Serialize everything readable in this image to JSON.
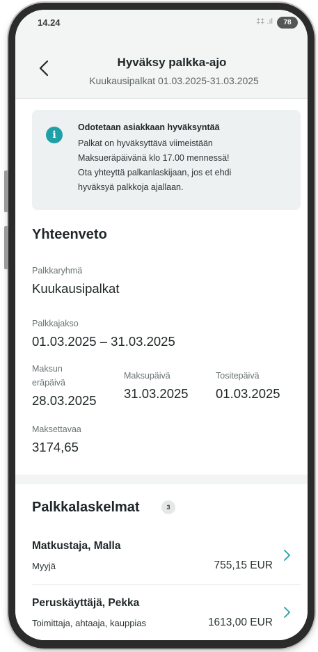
{
  "status_bar": {
    "time": "14.24",
    "signal_text": "‡‡ .ıl",
    "battery": "78"
  },
  "header": {
    "title": "Hyväksy palkka-ajo",
    "subtitle": "Kuukausipalkat 01.03.2025-31.03.2025"
  },
  "notice": {
    "icon": "info-icon",
    "title": "Odotetaan asiakkaan hyväksyntää",
    "lines": [
      "Palkat on hyväksyttävä viimeistään",
      "Maksueräpäivänä klo 17.00 mennessä!",
      "Ota yhteyttä palkanlaskijaan, jos et ehdi",
      "hyväksyä palkkoja ajallaan."
    ]
  },
  "summary": {
    "title": "Yhteenveto",
    "group_label": "Palkkaryhmä",
    "group_value": "Kuukausipalkat",
    "period_label": "Palkkajakso",
    "period_value": "01.03.2025 – 31.03.2025",
    "due_label_line1": "Maksun",
    "due_label_line2": "eräpäivä",
    "due_value": "28.03.2025",
    "paydate_label": "Maksupäivä",
    "paydate_value": "31.03.2025",
    "voucher_label": "Tositepäivä",
    "voucher_value": "01.03.2025",
    "payable_label": "Maksettavaa",
    "payable_value": "3174,65"
  },
  "payslips": {
    "title": "Palkkalaskelmat",
    "count": "3",
    "items": [
      {
        "name": "Matkustaja, Malla",
        "role": "Myyjä",
        "amount": "755,15 EUR"
      },
      {
        "name": "Peruskäyttäjä, Pekka",
        "role": "Toimittaja, ahtaaja, kauppias",
        "amount": "1613,00 EUR"
      }
    ]
  },
  "colors": {
    "accent": "#1fa0a8",
    "background_band": "#f3f4f4",
    "notice_background": "#eef1f1"
  }
}
